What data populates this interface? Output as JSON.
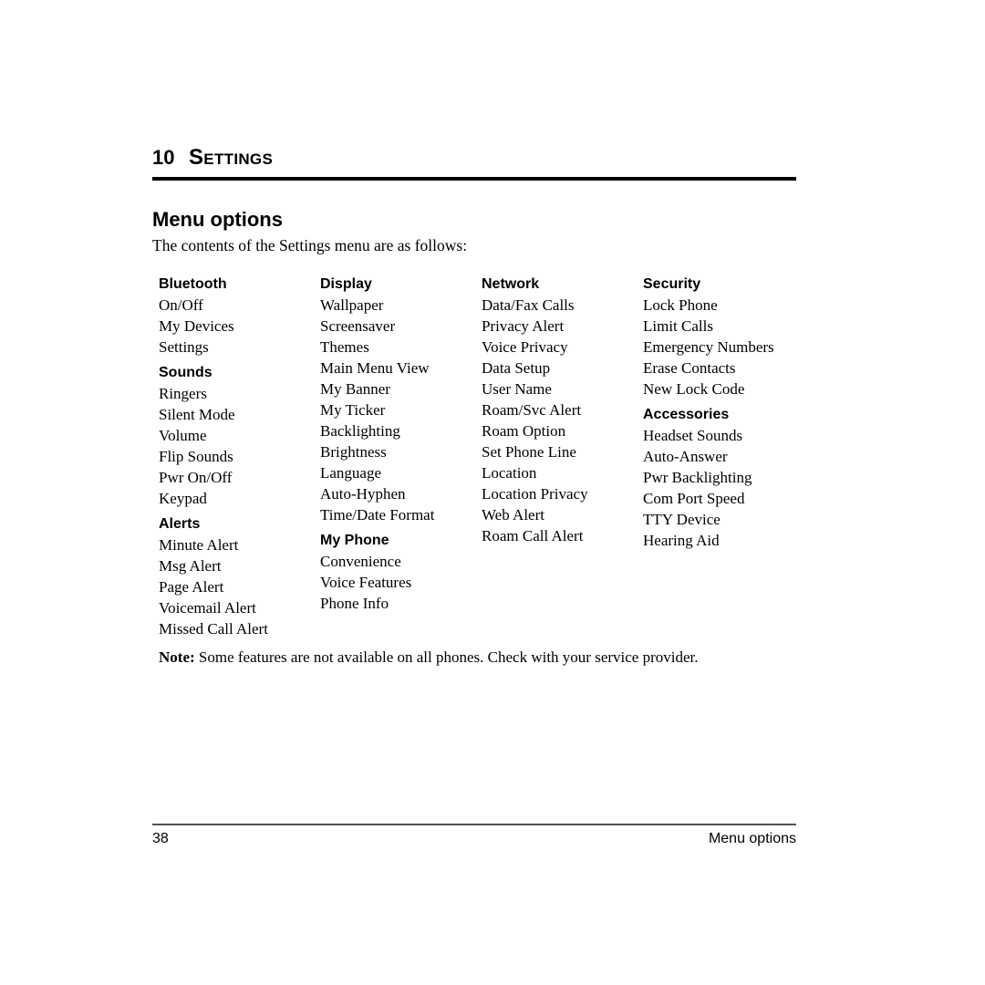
{
  "header": {
    "chapter_number": "10",
    "chapter_title": "Settings"
  },
  "section": {
    "title": "Menu options",
    "intro": "The contents of the Settings menu are as follows:"
  },
  "columns": [
    {
      "groups": [
        {
          "heading": "Bluetooth",
          "items": [
            "On/Off",
            "My Devices",
            "Settings"
          ]
        },
        {
          "heading": "Sounds",
          "items": [
            "Ringers",
            "Silent Mode",
            "Volume",
            "Flip Sounds",
            "Pwr On/Off",
            "Keypad"
          ]
        },
        {
          "heading": "Alerts",
          "items": [
            "Minute Alert",
            "Msg Alert",
            "Page Alert",
            "Voicemail Alert",
            "Missed Call Alert"
          ]
        }
      ]
    },
    {
      "groups": [
        {
          "heading": "Display",
          "items": [
            "Wallpaper",
            "Screensaver",
            "Themes",
            "Main Menu View",
            "My Banner",
            "My Ticker",
            "Backlighting",
            "Brightness",
            "Language",
            "Auto-Hyphen",
            "Time/Date Format"
          ]
        },
        {
          "heading": "My Phone",
          "items": [
            "Convenience",
            "Voice Features",
            "Phone Info"
          ]
        }
      ]
    },
    {
      "groups": [
        {
          "heading": "Network",
          "items": [
            "Data/Fax Calls",
            "Privacy Alert",
            "Voice Privacy",
            "Data Setup",
            "User Name",
            "Roam/Svc Alert",
            "Roam Option",
            "Set Phone Line",
            "Location",
            "Location Privacy",
            "Web Alert",
            "Roam Call Alert"
          ]
        }
      ]
    },
    {
      "groups": [
        {
          "heading": "Security",
          "items": [
            "Lock Phone",
            "Limit Calls",
            "Emergency Numbers",
            "Erase Contacts",
            "New Lock Code"
          ]
        },
        {
          "heading": "Accessories",
          "items": [
            "Headset Sounds",
            "Auto-Answer",
            "Pwr Backlighting",
            "Com Port Speed",
            "TTY Device",
            "Hearing Aid"
          ]
        }
      ]
    }
  ],
  "note": {
    "label": "Note:",
    "text": "Some features are not available on all phones. Check with your service provider."
  },
  "footer": {
    "page_number": "38",
    "running_title": "Menu options"
  }
}
